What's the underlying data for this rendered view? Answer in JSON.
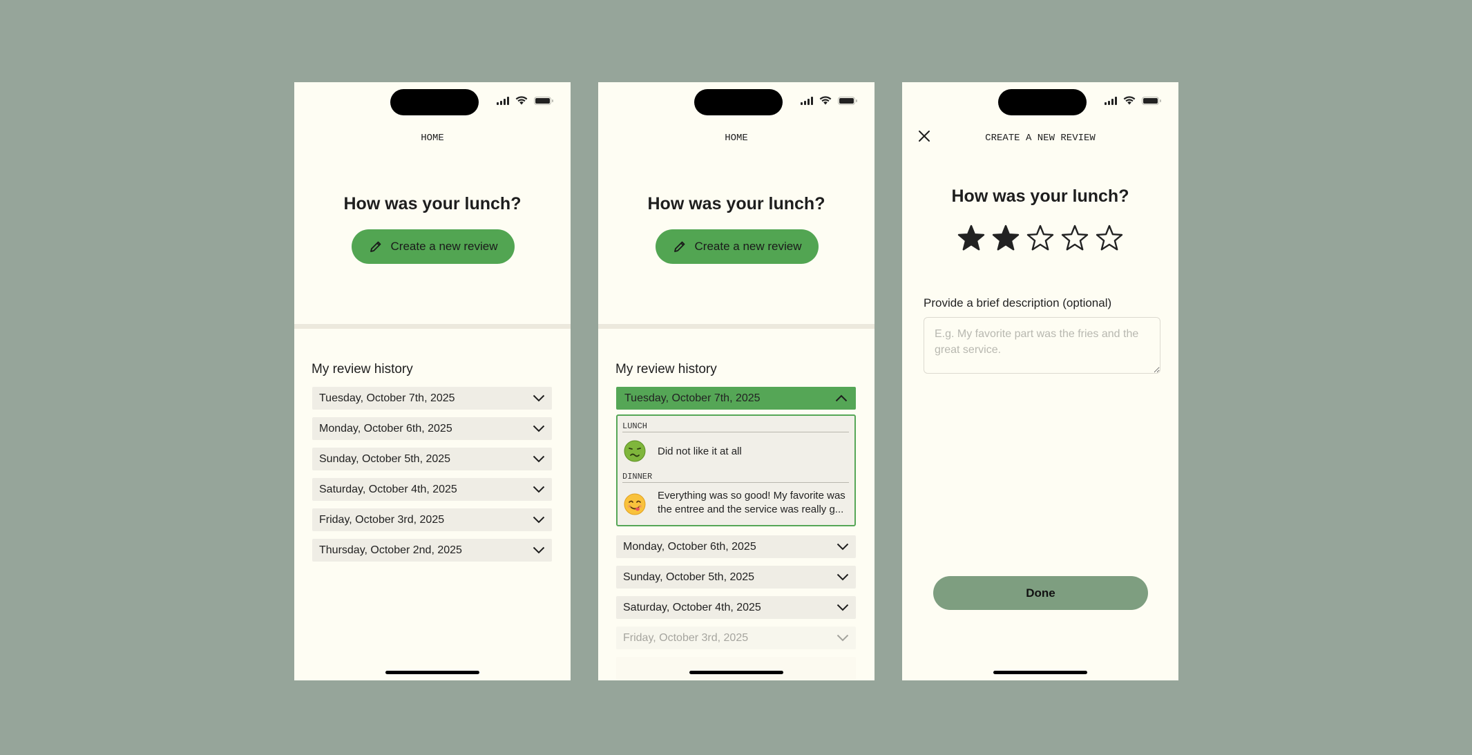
{
  "screens": {
    "home": {
      "nav_title": "HOME",
      "question": "How was your lunch?",
      "cta_label": "Create a new review",
      "history_title": "My review history",
      "dates": [
        "Tuesday, October 7th, 2025",
        "Monday, October 6th, 2025",
        "Sunday, October 5th, 2025",
        "Saturday, October 4th, 2025",
        "Friday, October 3rd, 2025",
        "Thursday, October 2nd, 2025"
      ]
    },
    "home_expanded": {
      "nav_title": "HOME",
      "question": "How was your lunch?",
      "cta_label": "Create a new review",
      "history_title": "My review history",
      "expanded_date": "Tuesday, October 7th, 2025",
      "entries": [
        {
          "meal": "LUNCH",
          "emoji": "nauseated-face-icon",
          "text": "Did not like it at all"
        },
        {
          "meal": "DINNER",
          "emoji": "savoring-face-icon",
          "text": "Everything was so good! My favorite was the entree and the service was really g..."
        }
      ],
      "dates": [
        "Monday, October 6th, 2025",
        "Sunday, October 5th, 2025",
        "Saturday, October 4th, 2025",
        "Friday, October 3rd, 2025"
      ]
    },
    "create_review": {
      "nav_title": "CREATE A NEW REVIEW",
      "question": "How was your lunch?",
      "rating": 2,
      "rating_max": 5,
      "description_label": "Provide a brief description (optional)",
      "description_placeholder": "E.g. My favorite part was the fries and the great service.",
      "description_value": "",
      "done_label": "Done"
    }
  },
  "colors": {
    "backdrop": "#96a59a",
    "screen_bg": "#fefdf3",
    "accent_green": "#52a552",
    "done_button": "#7e9e80",
    "row_bg": "#efede5"
  }
}
